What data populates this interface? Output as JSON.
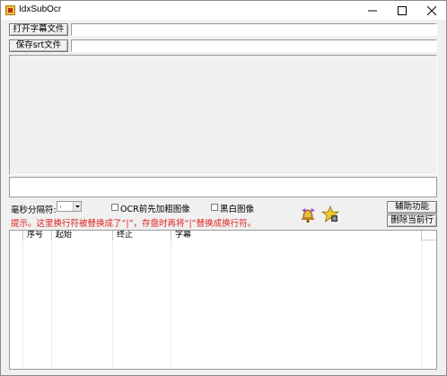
{
  "window": {
    "title": "IdxSubOcr"
  },
  "toolbar": {
    "open_button": "打开字幕文件",
    "open_path": "",
    "save_button": "保存srt文件",
    "save_path": ""
  },
  "options": {
    "ms_separator_label": "毫秒分隔符:",
    "ms_separator_value": ".",
    "bold_before_ocr_label": "OCR前先加粗图像",
    "bold_before_ocr_checked": false,
    "bw_image_label": "黑白图像",
    "bw_image_checked": false,
    "assist_button": "辅助功能",
    "delete_row_button": "删除当前行"
  },
  "hint": "提示。这里换行符被替换成了“|”，存盘时再将“|”替换成换行符。",
  "table": {
    "columns": [
      "序号",
      "起始",
      "终止",
      "字幕"
    ],
    "rows": []
  }
}
